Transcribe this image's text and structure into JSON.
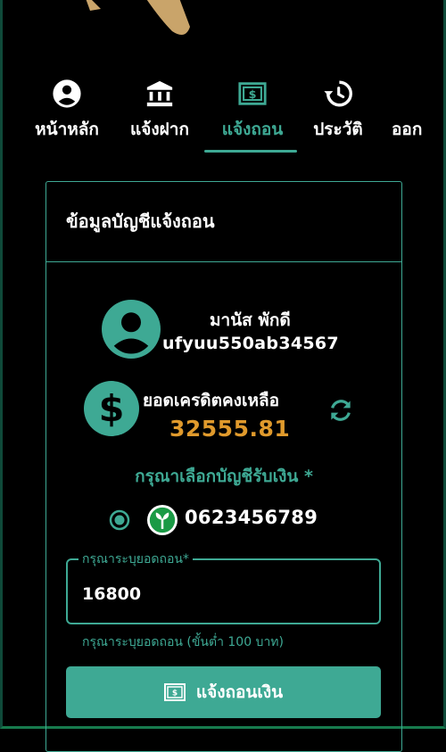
{
  "nav": {
    "items": [
      {
        "label": "หน้าหลัก",
        "icon": "account-circle-icon"
      },
      {
        "label": "แจ้งฝาก",
        "icon": "bank-icon"
      },
      {
        "label": "แจ้งถอน",
        "icon": "money-icon",
        "active": true
      },
      {
        "label": "ประวัติ",
        "icon": "history-icon"
      },
      {
        "label": "ออก",
        "icon": "logout-icon"
      }
    ]
  },
  "card": {
    "title": "ข้อมูลบัญชีแจ้งถอน",
    "user": {
      "name": "มานัส พักดี",
      "username": "ufyuu550ab34567"
    },
    "credit": {
      "label": "ยอดเครดิตคงเหลือ",
      "value": "32555.81"
    },
    "select_account_label": "กรุณาเลือกบัญชีรับเงิน *",
    "account": {
      "number": "0623456789",
      "bank_icon": "kbank-icon"
    },
    "amount": {
      "legend": "กรุณาระบุยอดถอน*",
      "value": "16800",
      "hint": "กรุณาระบุยอดถอน (ขั้นต่ำ 100 บาท)"
    },
    "submit_label": "แจ้งถอนเงิน"
  },
  "colors": {
    "accent": "#3ea994",
    "credit": "#e09a2c",
    "background": "#000000"
  }
}
